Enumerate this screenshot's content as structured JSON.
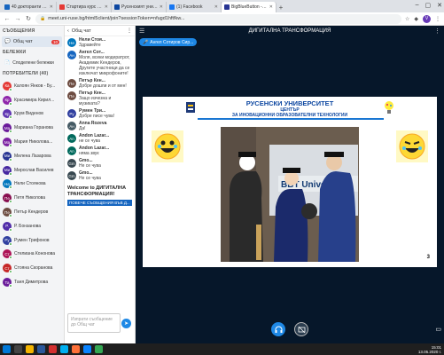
{
  "browser": {
    "tabs": [
      {
        "title": "40 докторанти от Русенск",
        "color": "#1565c0",
        "active": false
      },
      {
        "title": "Стартира курс по англий",
        "color": "#e53935",
        "active": false
      },
      {
        "title": "Русенският университет д",
        "color": "#0d47a1",
        "active": false
      },
      {
        "title": "(1) Facebook",
        "color": "#1877f2",
        "active": false
      },
      {
        "title": "BigBlueButton - ДИГИТ",
        "color": "#283593",
        "active": true
      }
    ],
    "url": "meet.uni-ruse.bg/html5client/join?sessionToken=nfugd1hftfkw...",
    "profile_letter": "V"
  },
  "left": {
    "messages_header": "СЪОБЩЕНИЯ",
    "public_chat": "Общ чат",
    "chat_badge": "10",
    "notes_header": "БЕЛЕЖКИ",
    "shared_notes": "Споделени бележки",
    "users_header": "ПОТРЕБИТЕЛИ (40)",
    "users": [
      {
        "initials": "Ка",
        "name": "Калоян Янков - Бу...",
        "color": "#e53935"
      },
      {
        "initials": "Кр",
        "name": "Красимира Кирил...",
        "color": "#8e24aa"
      },
      {
        "initials": "Кр",
        "name": "Крум Виденов",
        "color": "#5e35b1"
      },
      {
        "initials": "Ма",
        "name": "Мариана Горанова",
        "color": "#6a1b9a"
      },
      {
        "initials": "Ма",
        "name": "Мария Николова...",
        "color": "#7b1fa2"
      },
      {
        "initials": "Ми",
        "name": "Милена Лазарова",
        "color": "#283593"
      },
      {
        "initials": "Ми",
        "name": "Мирослав Василев",
        "color": "#4527a0"
      },
      {
        "initials": "Не",
        "name": "Нели Стоянова",
        "color": "#0277bd"
      },
      {
        "initials": "Пе",
        "name": "Петя Николова",
        "color": "#880e4f"
      },
      {
        "initials": "Пе",
        "name": "Петър Кендеров",
        "color": "#6d4c41"
      },
      {
        "initials": "Р.",
        "name": "Р. Бонзанова",
        "color": "#512da8"
      },
      {
        "initials": "Ру",
        "name": "Румен Трифонов",
        "color": "#303f9f"
      },
      {
        "initials": "Ст",
        "name": "Стелиана Кононова",
        "color": "#ad1457"
      },
      {
        "initials": "Ст",
        "name": "Стояна Скоранова",
        "color": "#c62828"
      },
      {
        "initials": "Та",
        "name": "Таня Димитрова",
        "color": "#6a1b9a"
      }
    ]
  },
  "chat": {
    "title": "Общ чат",
    "messages": [
      {
        "initials": "Не",
        "name": "Нели Стоя...",
        "time": "",
        "text": "Здравейте",
        "color": "#0277bd"
      },
      {
        "initials": "Ан",
        "name": "Ангел Сот...",
        "time": "",
        "text": "Моля, всеки модератрот, Академик Кендеров, Другите участници да се изключат микрофоните!",
        "color": "#1565c0"
      },
      {
        "initials": "Пе",
        "name": "Петър Кен...",
        "time": "",
        "text": "Добре дошли и от мен!",
        "color": "#6d4c41"
      },
      {
        "initials": "Пе",
        "name": "Петър Кен...",
        "time": "",
        "text": "Защо изчезна и музиката?",
        "color": "#6d4c41"
      },
      {
        "initials": "Ру",
        "name": "Румен Три...",
        "time": "",
        "text": "Добре писе чува!",
        "color": "#303f9f"
      },
      {
        "initials": "Ан",
        "name": "Anna Rozeva",
        "time": "",
        "text": "Да!",
        "color": "#455a64"
      },
      {
        "initials": "An",
        "name": "Andon Lazar...",
        "time": "",
        "text": "не се чува",
        "color": "#00695c"
      },
      {
        "initials": "An",
        "name": "Andon Lazar...",
        "time": "",
        "text": "няма звук",
        "color": "#00695c"
      },
      {
        "initials": "Gm",
        "name": "Gmo...",
        "time": "",
        "text": "Не се чува",
        "color": "#37474f"
      },
      {
        "initials": "Gm",
        "name": "Gmo...",
        "time": "",
        "text": "Не се чува",
        "color": "#37474f"
      }
    ],
    "welcome_title": "Welcome to ДИГИТАЛНА ТРАНСФОРМАЦИЯ!",
    "welcome_bar": "ПОВЕЧЕ СЪОБЩЕНИЯ ВЪВ Д...",
    "input_placeholder": "Изпрати съобщение до Общ чат"
  },
  "main": {
    "meeting_title": "ДИГИТАЛНА ТРАНСФОРМАЦИЯ",
    "presenter": "Ангел Сотиров Сир...",
    "slide_title": "РУСЕНСКИ УНИВЕРСИТЕТ",
    "slide_sub1": "ЦЕНТЪР",
    "slide_sub2": "ЗА ИНОВАЦИОННИ ОБРАЗОВАТЕЛНИ ТЕХНОЛОГИИ",
    "photo_text": "BBT Universi",
    "page_number": "3"
  },
  "taskbar": {
    "time": "15:01",
    "date": "13.05.2020 г."
  },
  "colors": {
    "accent": "#1e88e5",
    "main_bg": "#06172a"
  }
}
